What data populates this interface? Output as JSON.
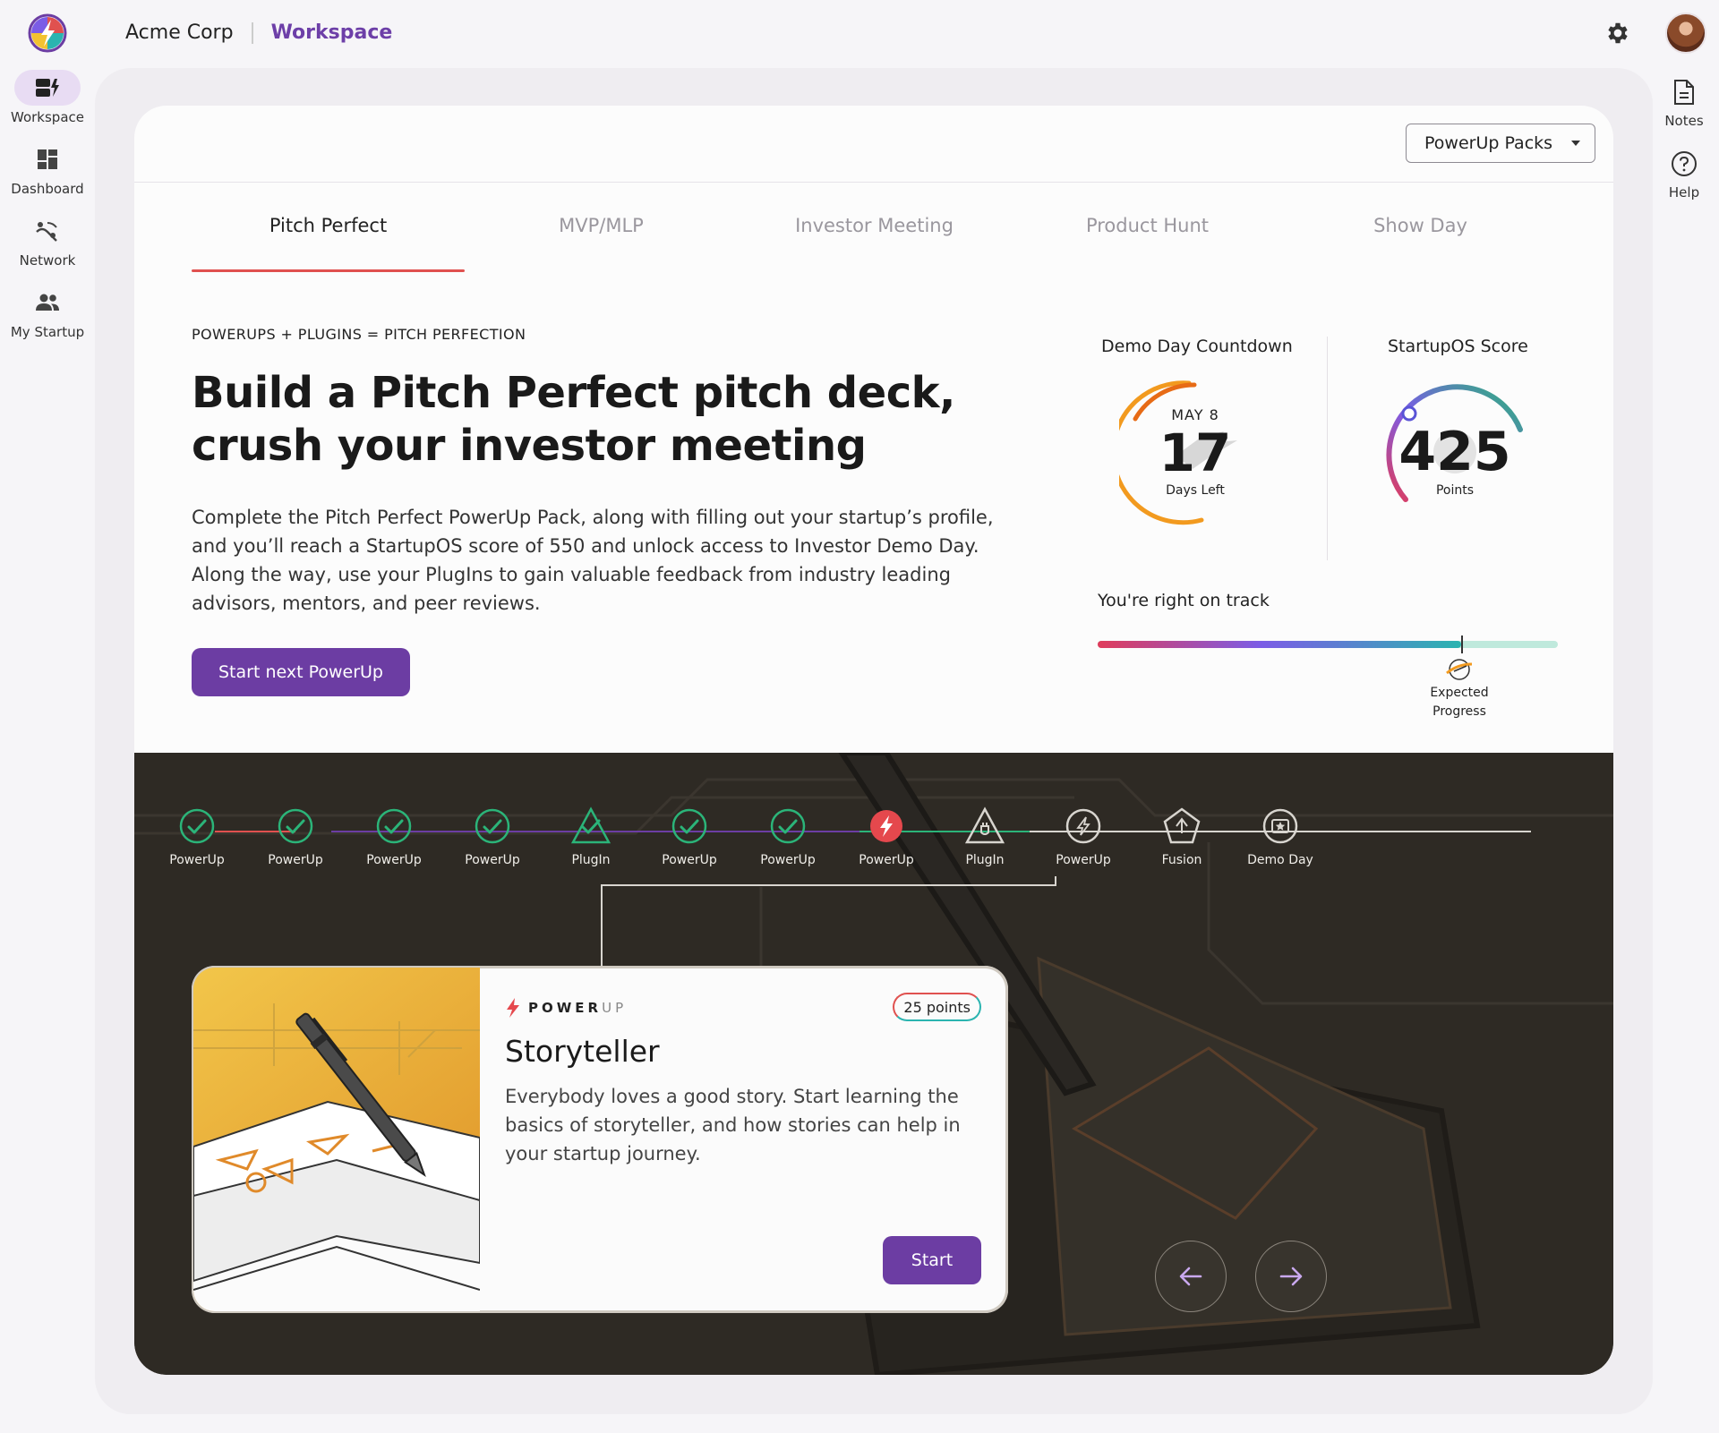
{
  "header": {
    "org_name": "Acme Corp",
    "section": "Workspace",
    "icons": [
      "app-logo",
      "gear-icon",
      "user-avatar"
    ]
  },
  "left_nav": {
    "items": [
      {
        "label": "Workspace",
        "icon": "workspace-icon",
        "active": true
      },
      {
        "label": "Dashboard",
        "icon": "dashboard-icon",
        "active": false
      },
      {
        "label": "Network",
        "icon": "network-icon",
        "active": false
      },
      {
        "label": "My Startup",
        "icon": "people-icon",
        "active": false
      }
    ]
  },
  "right_nav": {
    "items": [
      {
        "label": "Notes",
        "icon": "document-icon"
      },
      {
        "label": "Help",
        "icon": "help-icon"
      }
    ]
  },
  "pack_select": {
    "value": "PowerUp Packs"
  },
  "tabs": [
    {
      "label": "Pitch Perfect",
      "active": true
    },
    {
      "label": "MVP/MLP",
      "active": false
    },
    {
      "label": "Investor Meeting",
      "active": false
    },
    {
      "label": "Product Hunt",
      "active": false
    },
    {
      "label": "Show Day",
      "active": false
    }
  ],
  "hero": {
    "eyebrow": "POWERUPS + PLUGINS = PITCH PERFECTION",
    "headline": "Build a Pitch Perfect pitch deck, crush your investor meeting",
    "description": "Complete the Pitch Perfect PowerUp Pack, along with filling out your startup’s profile, and you’ll reach a StartupOS score of 550 and unlock access to Investor Demo Day. Along the way, use your PlugIns to gain valuable feedback from industry leading advisors, mentors, and peer reviews.",
    "cta_label": "Start next PowerUp"
  },
  "countdown": {
    "title": "Demo Day Countdown",
    "date": "MAY 8",
    "days": "17",
    "days_label": "Days Left",
    "accent": "#f29a1f"
  },
  "score": {
    "title": "StartupOS Score",
    "value": "425",
    "unit": "Points",
    "score_fraction": 0.77
  },
  "track": {
    "status": "You're right on track",
    "progress_fraction": 0.79,
    "expected_label_line1": "Expected",
    "expected_label_line2": "Progress"
  },
  "journey": {
    "steps": [
      {
        "label": "PowerUp",
        "state": "done",
        "shape": "circle"
      },
      {
        "label": "PowerUp",
        "state": "done",
        "shape": "circle"
      },
      {
        "label": "PowerUp",
        "state": "done",
        "shape": "circle"
      },
      {
        "label": "PowerUp",
        "state": "done",
        "shape": "circle"
      },
      {
        "label": "PlugIn",
        "state": "done",
        "shape": "triangle"
      },
      {
        "label": "PowerUp",
        "state": "done",
        "shape": "circle"
      },
      {
        "label": "PowerUp",
        "state": "done",
        "shape": "circle"
      },
      {
        "label": "PowerUp",
        "state": "current",
        "shape": "circle"
      },
      {
        "label": "PlugIn",
        "state": "locked",
        "shape": "triangle"
      },
      {
        "label": "PowerUp",
        "state": "locked",
        "shape": "circle"
      },
      {
        "label": "Fusion",
        "state": "locked",
        "shape": "pentagon"
      },
      {
        "label": "Demo Day",
        "state": "locked",
        "shape": "circle"
      }
    ],
    "colors": {
      "done": "#2bb479",
      "current": "#e5484d",
      "locked": "#d8d5cf"
    }
  },
  "powerup_card": {
    "brand_bold": "POWER",
    "brand_light": "UP",
    "points": "25 points",
    "title": "Storyteller",
    "description": "Everybody loves a good story. Start learning the basics of storyteller, and how stories can help in your startup journey.",
    "start_label": "Start"
  },
  "carousel": {
    "prev_icon": "arrow-left-icon",
    "next_icon": "arrow-right-icon"
  }
}
